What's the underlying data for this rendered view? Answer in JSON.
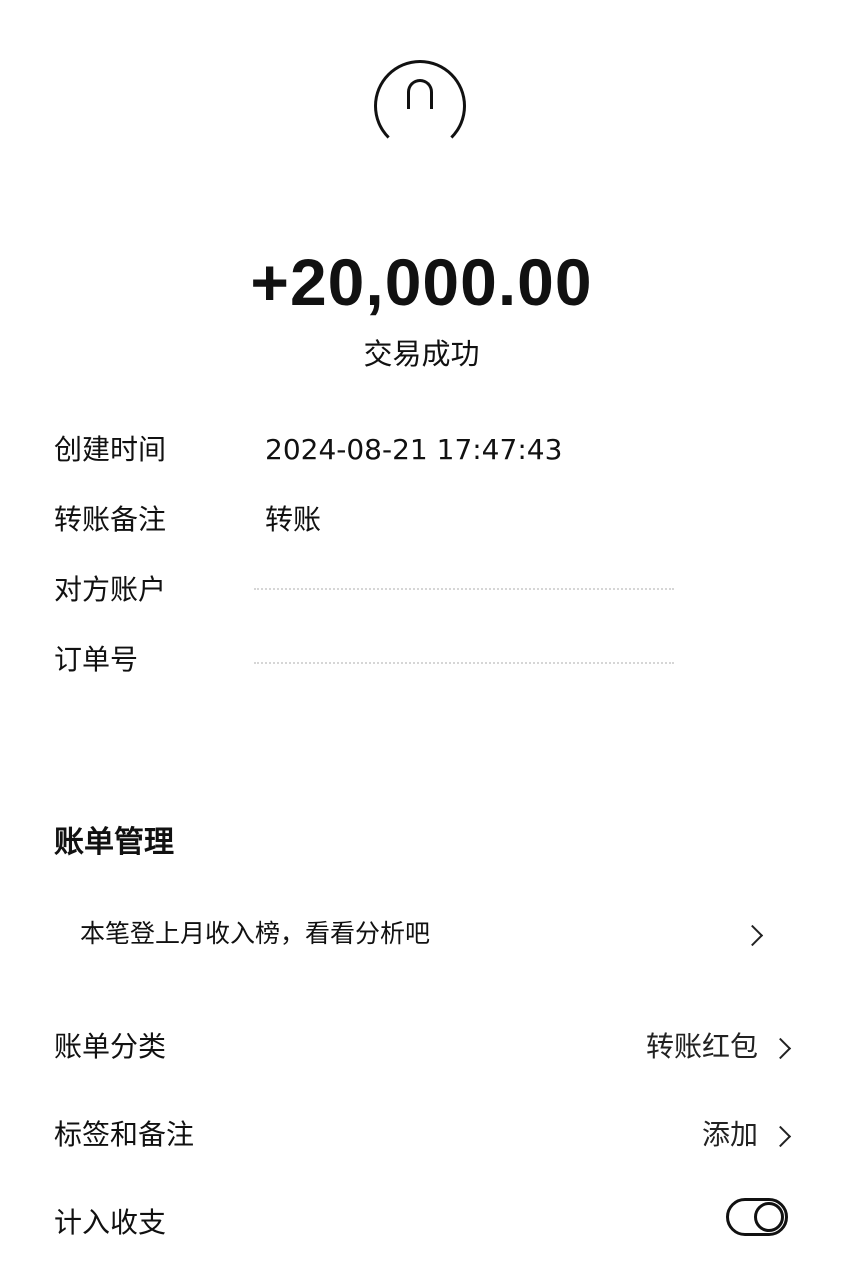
{
  "header": {
    "avatar_icon": "user-avatar-icon",
    "amount": "+20,000.00",
    "status": "交易成功"
  },
  "details": [
    {
      "label": "创建时间",
      "value": "2024-08-21 17:47:43"
    },
    {
      "label": "转账备注",
      "value": "转账"
    },
    {
      "label": "对方账户",
      "value": ""
    },
    {
      "label": "订单号",
      "value": ""
    }
  ],
  "bill_management": {
    "title": "账单管理",
    "insight_text": "本笔登上月收入榜，看看分析吧",
    "category_label": "账单分类",
    "category_value": "转账红包",
    "tags_label": "标签和备注",
    "tags_value": "添加",
    "count_label": "计入收支",
    "count_toggle_on": true
  }
}
